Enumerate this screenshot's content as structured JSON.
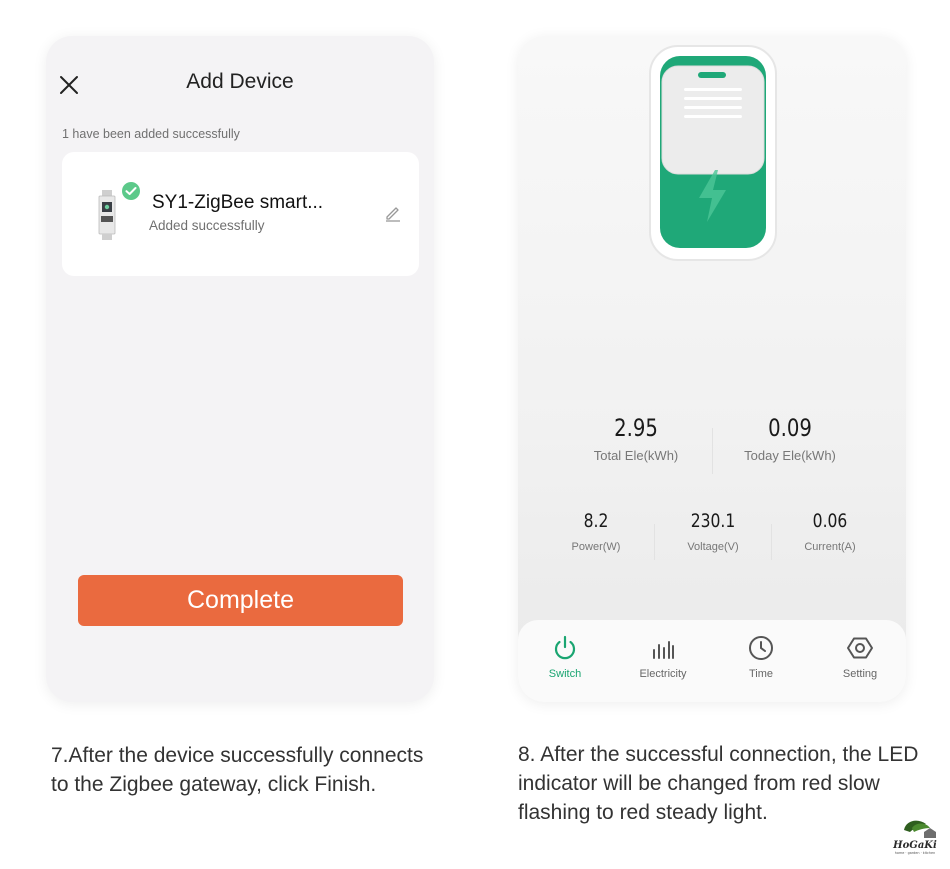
{
  "left_screen": {
    "title": "Add Device",
    "added_message": "1 have been added successfully",
    "device": {
      "name": "SY1-ZigBee smart...",
      "status": "Added successfully"
    },
    "complete_label": "Complete",
    "accent_color": "#ea6a3f"
  },
  "right_screen": {
    "stats_top": [
      {
        "value": "2.95",
        "label": "Total Ele(kWh)"
      },
      {
        "value": "0.09",
        "label": "Today Ele(kWh)"
      }
    ],
    "stats_bottom": [
      {
        "value": "8.2",
        "label": "Power(W)"
      },
      {
        "value": "230.1",
        "label": "Voltage(V)"
      },
      {
        "value": "0.06",
        "label": "Current(A)"
      }
    ],
    "tabs": [
      {
        "label": "Switch",
        "icon": "power-icon",
        "active": true
      },
      {
        "label": "Electricity",
        "icon": "bar-chart-icon",
        "active": false
      },
      {
        "label": "Time",
        "icon": "clock-icon",
        "active": false
      },
      {
        "label": "Setting",
        "icon": "hexagon-settings-icon",
        "active": false
      }
    ],
    "accent_color": "#1aa571"
  },
  "captions": {
    "left": "7.After the device successfully connects to the Zigbee gateway, click Finish.",
    "right": "8. After the successful connection, the LED indicator will be changed from red slow flashing to red steady light."
  },
  "logo": {
    "name": "HoGaKi",
    "tagline": "home garden kitchen"
  }
}
